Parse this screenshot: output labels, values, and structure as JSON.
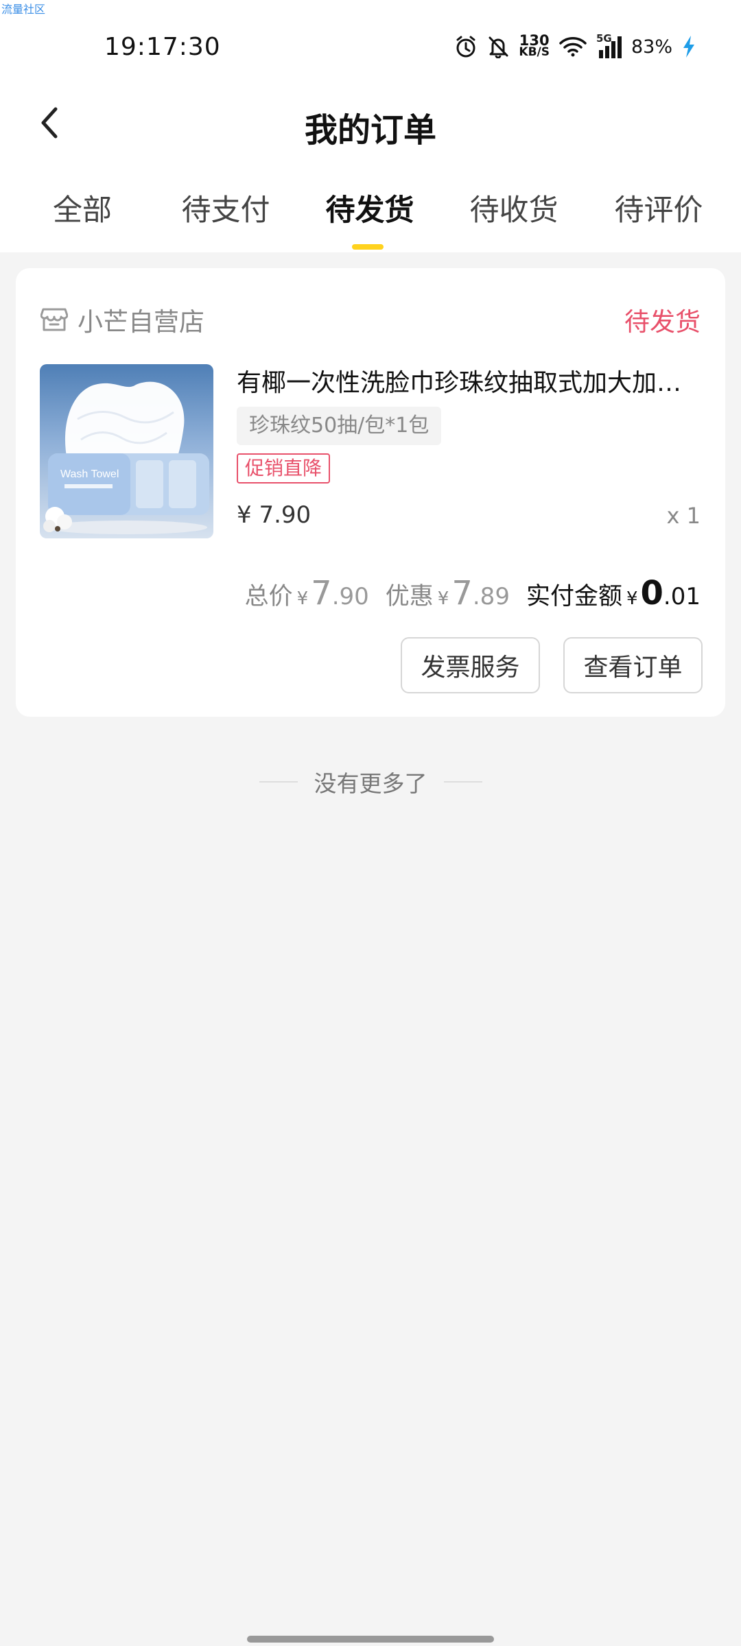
{
  "watermark": "流量社区",
  "status_bar": {
    "time": "19:17:30",
    "net_speed_value": "130",
    "net_speed_unit": "KB/S",
    "signal_label": "5G",
    "battery": "83%",
    "icons": [
      "alarm-icon",
      "bell-muted-icon",
      "wifi-icon",
      "signal-icon",
      "charging-icon"
    ]
  },
  "header": {
    "title": "我的订单"
  },
  "tabs": [
    {
      "label": "全部",
      "active": false
    },
    {
      "label": "待支付",
      "active": false
    },
    {
      "label": "待发货",
      "active": true
    },
    {
      "label": "待收货",
      "active": false
    },
    {
      "label": "待评价",
      "active": false
    }
  ],
  "order": {
    "shop_name": "小芒自营店",
    "status": "待发货",
    "product": {
      "title": "有椰一次性洗脸巾珍珠纹抽取式加大加厚洗面巾",
      "spec": "珍珠纹50抽/包*1包",
      "promo": "促销直降",
      "price": "¥ 7.90",
      "quantity": "x 1",
      "image_text": "Wash Towel"
    },
    "summary": {
      "total_label": "总价",
      "total_currency": "¥",
      "total_int": "7",
      "total_dec": ".90",
      "discount_label": "优惠",
      "discount_currency": "¥",
      "discount_int": "7",
      "discount_dec": ".89",
      "paid_label": "实付金额",
      "paid_currency": "¥",
      "paid_int": "0",
      "paid_dec": ".01"
    },
    "buttons": {
      "invoice": "发票服务",
      "view": "查看订单"
    }
  },
  "footer": {
    "no_more": "没有更多了"
  },
  "colors": {
    "accent_yellow": "#ffd21e",
    "status_red": "#e8506a",
    "background": "#f4f4f4"
  }
}
